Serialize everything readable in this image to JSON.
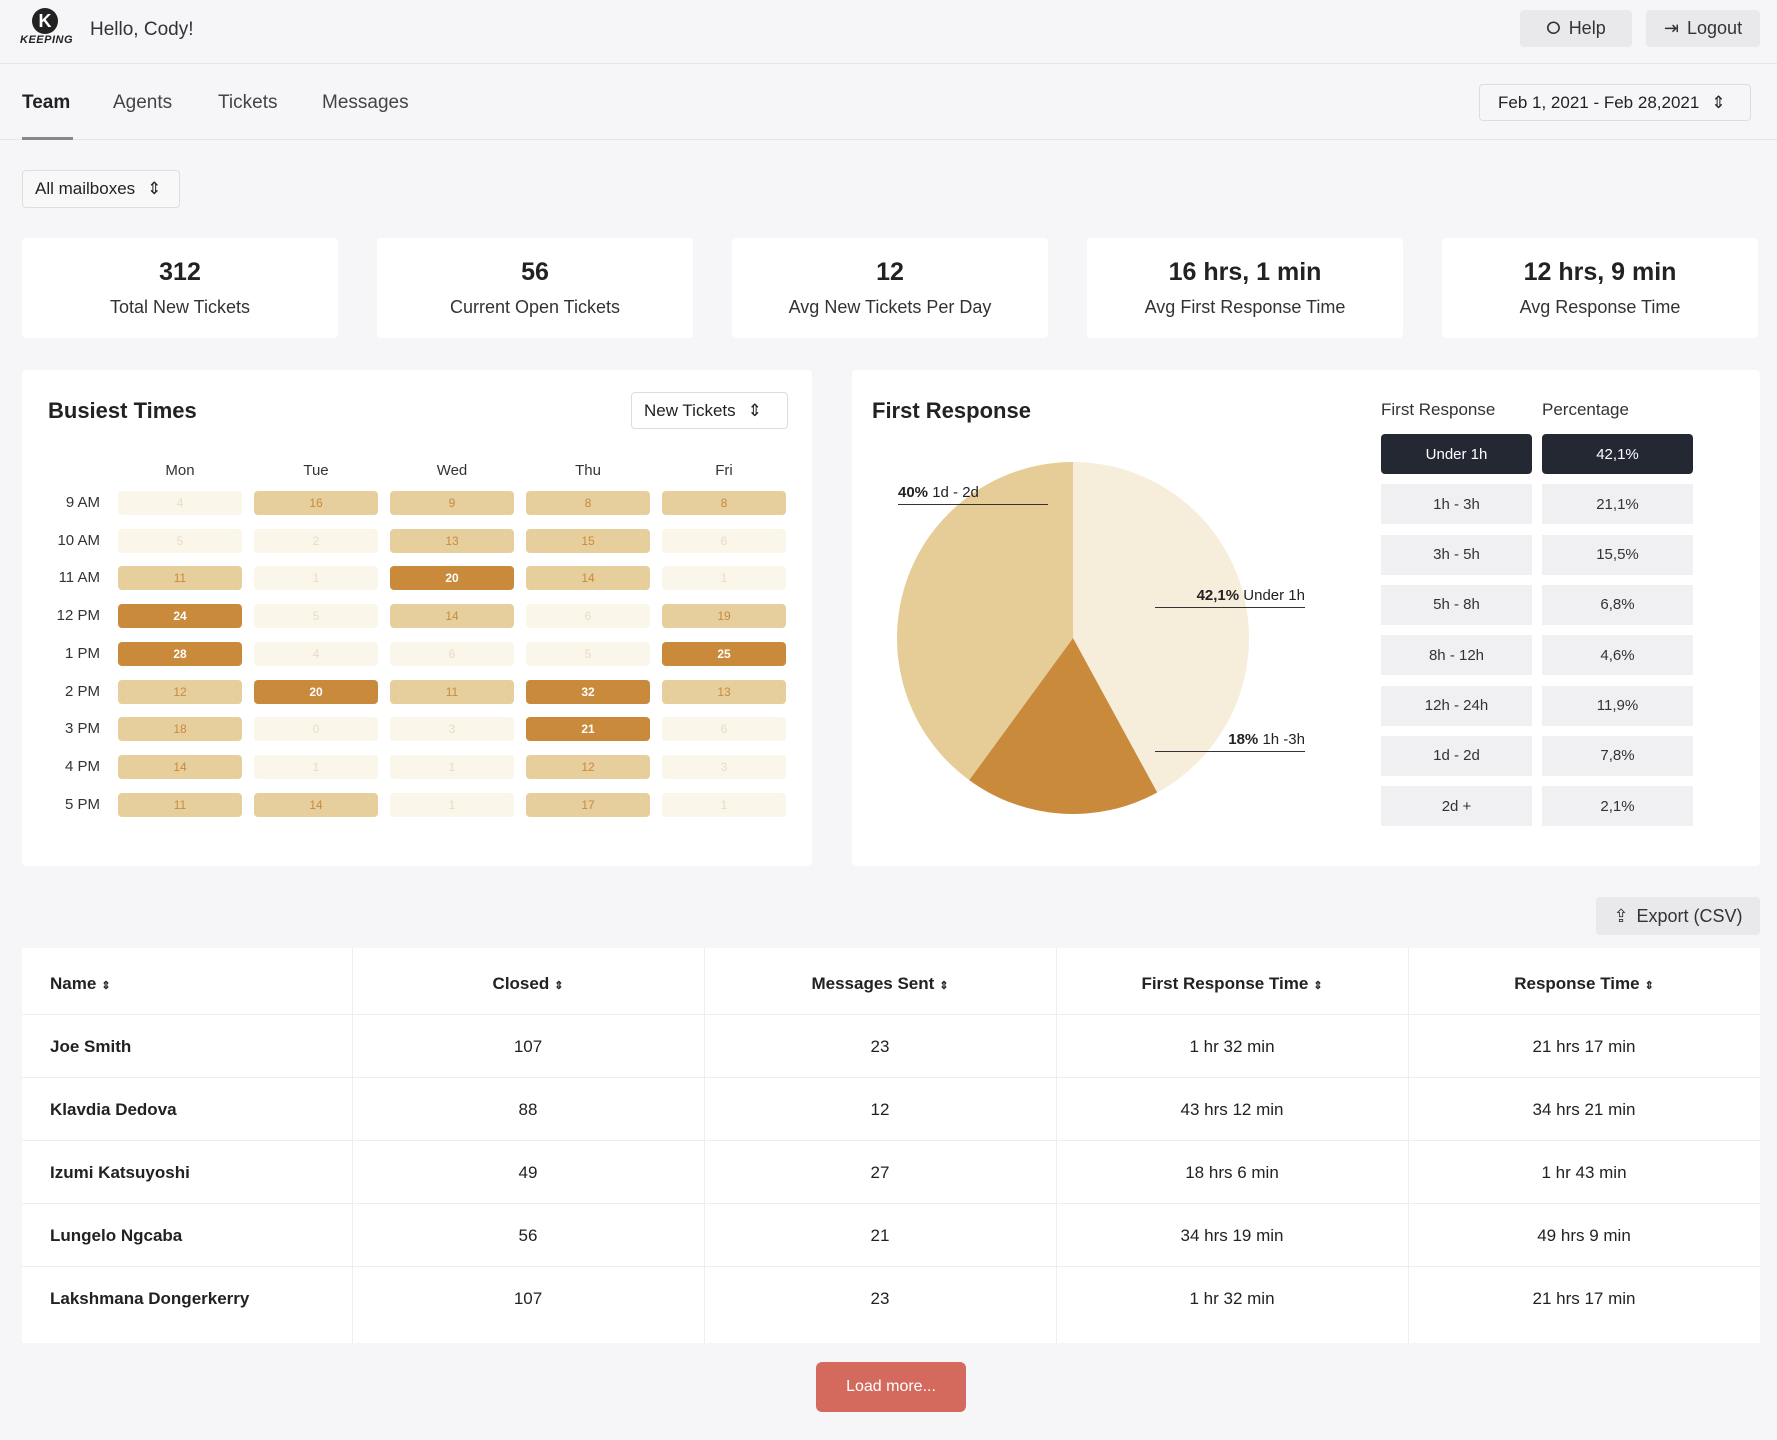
{
  "header": {
    "logo": "KEEPING",
    "greeting": "Hello, Cody!",
    "help": "Help",
    "logout": "Logout"
  },
  "tabs": [
    "Team",
    "Agents",
    "Tickets",
    "Messages"
  ],
  "date_range": "Feb 1, 2021 - Feb 28,2021",
  "mailbox": "All mailboxes",
  "stats": [
    {
      "value": "312",
      "label": "Total New Tickets"
    },
    {
      "value": "56",
      "label": "Current Open Tickets"
    },
    {
      "value": "12",
      "label": "Avg New Tickets Per Day"
    },
    {
      "value": "16 hrs, 1 min",
      "label": "Avg First Response Time"
    },
    {
      "value": "12 hrs, 9 min",
      "label": "Avg Response Time"
    }
  ],
  "busiest": {
    "title": "Busiest Times",
    "metric": "New Tickets",
    "days": [
      "Mon",
      "Tue",
      "Wed",
      "Thu",
      "Fri"
    ],
    "hours": [
      "9 AM",
      "10 AM",
      "11 AM",
      "12 PM",
      "1 PM",
      "2 PM",
      "3 PM",
      "4 PM",
      "5 PM"
    ],
    "values": [
      [
        4,
        16,
        9,
        8,
        8
      ],
      [
        5,
        2,
        13,
        15,
        6
      ],
      [
        11,
        1,
        20,
        14,
        1
      ],
      [
        24,
        5,
        14,
        6,
        19
      ],
      [
        28,
        4,
        6,
        5,
        25
      ],
      [
        12,
        20,
        11,
        32,
        13
      ],
      [
        18,
        0,
        3,
        21,
        6
      ],
      [
        14,
        1,
        1,
        12,
        3
      ],
      [
        11,
        14,
        1,
        17,
        1
      ]
    ]
  },
  "first_response": {
    "title": "First Response",
    "col1": "First Response",
    "col2": "Percentage",
    "rows": [
      [
        "Under 1h",
        "42,1%"
      ],
      [
        "1h - 3h",
        "21,1%"
      ],
      [
        "3h - 5h",
        "15,5%"
      ],
      [
        "5h - 8h",
        "6,8%"
      ],
      [
        "8h - 12h",
        "4,6%"
      ],
      [
        "12h - 24h",
        "11,9%"
      ],
      [
        "1d - 2d",
        "7,8%"
      ],
      [
        "2d +",
        "2,1%"
      ]
    ],
    "pie": [
      {
        "pct": "42,1%",
        "label": "Under 1h",
        "value": 42.1,
        "color": "#f6eedb"
      },
      {
        "pct": "18%",
        "label": "1h -3h",
        "value": 18,
        "color": "#c98a3c"
      },
      {
        "pct": "40%",
        "label": "1d - 2d",
        "value": 40,
        "color": "#e6cd98"
      }
    ]
  },
  "export": "Export (CSV)",
  "table": {
    "headers": [
      "Name",
      "Closed",
      "Messages Sent",
      "First Response Time",
      "Response Time"
    ],
    "rows": [
      [
        "Joe Smith",
        "107",
        "23",
        "1 hr 32 min",
        "21 hrs 17 min"
      ],
      [
        "Klavdia Dedova",
        "88",
        "12",
        "43 hrs 12 min",
        "34 hrs 21 min"
      ],
      [
        "Izumi Katsuyoshi",
        "49",
        "27",
        "18 hrs 6 min",
        "1 hr 43 min"
      ],
      [
        "Lungelo Ngcaba",
        "56",
        "21",
        "34 hrs 19 min",
        "49 hrs 9 min"
      ],
      [
        "Lakshmana Dongerkerry",
        "107",
        "23",
        "1 hr 32 min",
        "21 hrs 17 min"
      ]
    ]
  },
  "load_more": "Load more..."
}
